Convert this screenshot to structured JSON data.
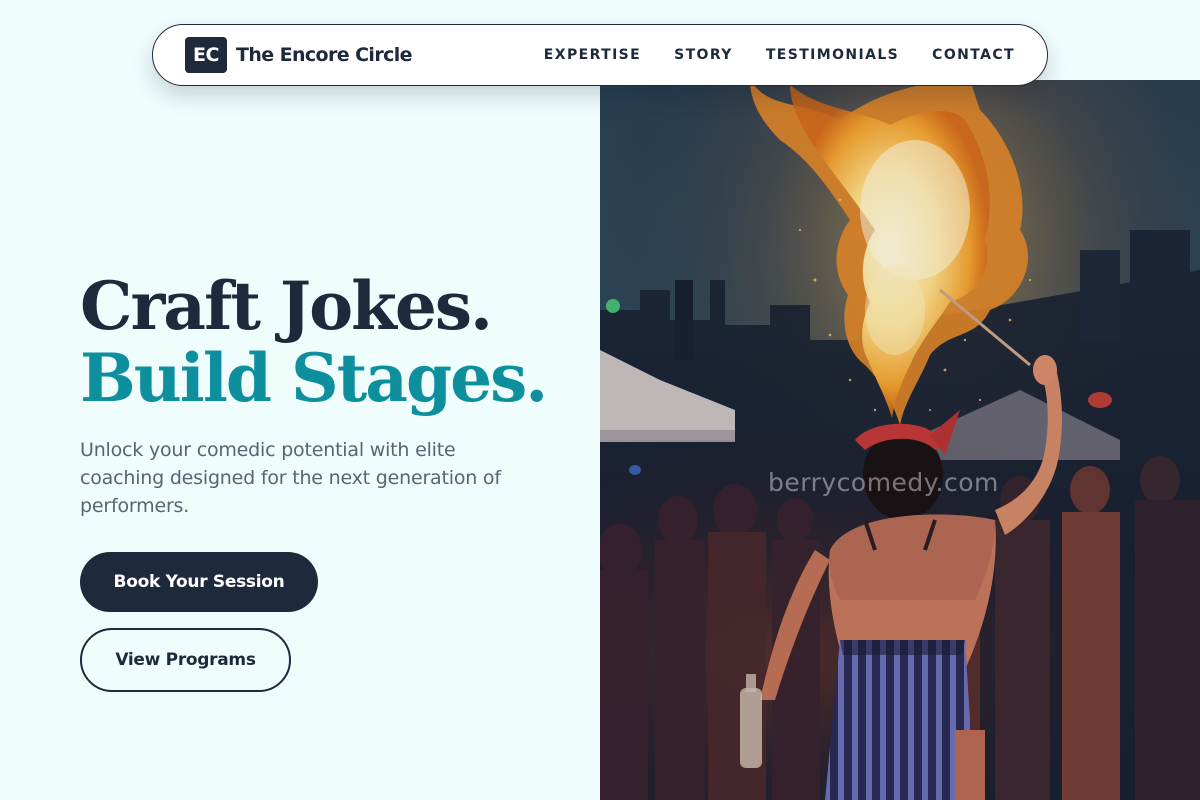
{
  "nav": {
    "logo_text": "EC",
    "brand_name": "The Encore Circle",
    "links": [
      {
        "label": "EXPERTISE"
      },
      {
        "label": "STORY"
      },
      {
        "label": "TESTIMONIALS"
      },
      {
        "label": "CONTACT"
      }
    ]
  },
  "hero": {
    "headline_line1": "Craft Jokes.",
    "headline_line2": "Build Stages.",
    "subtext": "Unlock your comedic potential with elite coaching designed for the next generation of performers.",
    "primary_cta": "Book Your Session",
    "secondary_cta": "View Programs"
  },
  "photo": {
    "watermark": "berrycomedy.com"
  },
  "colors": {
    "background": "#effdfd",
    "navy": "#1e293b",
    "accent_teal": "#0e8f9e",
    "body_text": "#5b6372"
  }
}
